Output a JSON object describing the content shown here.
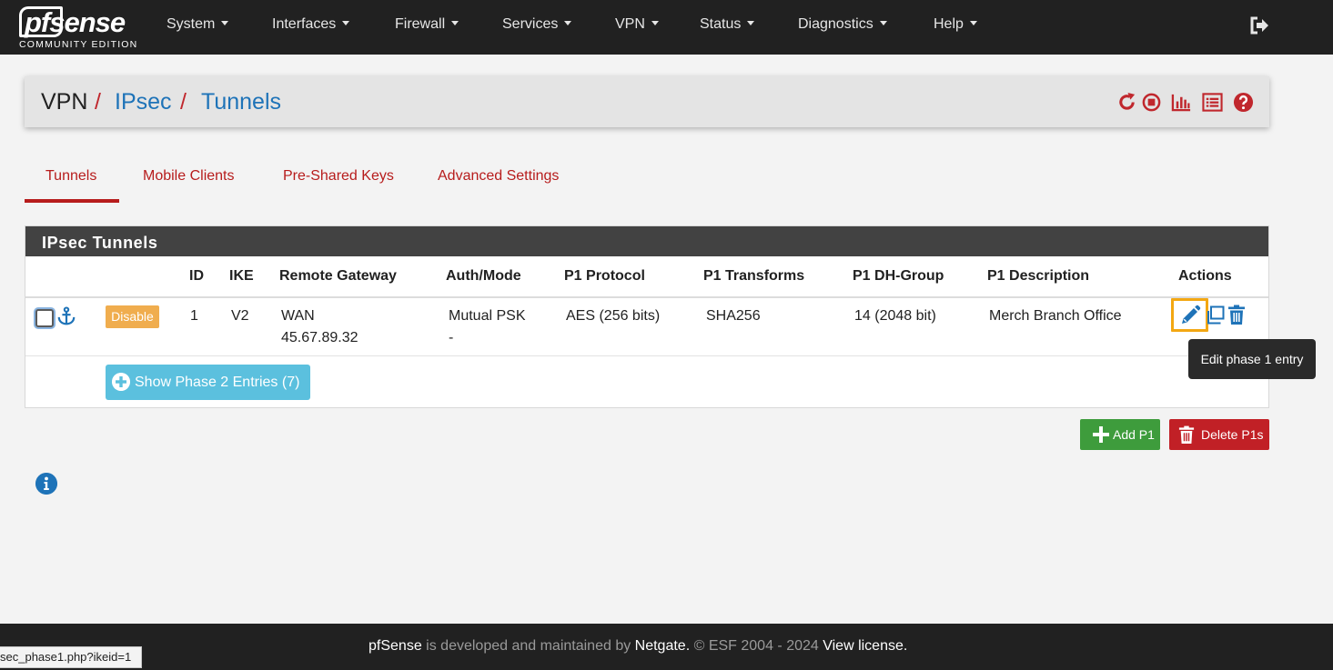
{
  "brand": {
    "name": "pfsense",
    "edition": "COMMUNITY EDITION"
  },
  "nav": {
    "items": [
      "System",
      "Interfaces",
      "Firewall",
      "Services",
      "VPN",
      "Status",
      "Diagnostics",
      "Help"
    ],
    "logout_icon": "sign-out-icon"
  },
  "breadcrumb": {
    "root": "VPN",
    "section": "IPsec",
    "page": "Tunnels",
    "separator": "/"
  },
  "header_icons": [
    "restart-service-icon",
    "stop-service-icon",
    "bar-chart-icon",
    "list-icon",
    "help-icon"
  ],
  "tabs": [
    "Tunnels",
    "Mobile Clients",
    "Pre-Shared Keys",
    "Advanced Settings"
  ],
  "active_tab": "Tunnels",
  "panel": {
    "title": "IPsec Tunnels",
    "columns": [
      "ID",
      "IKE",
      "Remote Gateway",
      "Auth/Mode",
      "P1 Protocol",
      "P1 Transforms",
      "P1 DH-Group",
      "P1 Description",
      "Actions"
    ],
    "rows": [
      {
        "disable_label": "Disable",
        "id": "1",
        "ike": "V2",
        "gateway_iface": "WAN",
        "gateway_ip": "45.67.89.32",
        "auth": "Mutual PSK",
        "mode": "-",
        "protocol": "AES (256 bits)",
        "transforms": "SHA256",
        "dh_group": "14 (2048 bit)",
        "description": "Merch Branch Office"
      }
    ],
    "phase2_button": "Show Phase 2 Entries (7)"
  },
  "tooltip": "Edit phase 1 entry",
  "buttons": {
    "add": "Add P1",
    "delete": "Delete P1s"
  },
  "footer": {
    "brand": "pfSense",
    "developed": " is developed and maintained by ",
    "company": "Netgate.",
    "copyright": " © ESF 2004 - 2024 ",
    "license": "View license."
  },
  "status_bar_url": "sec_phase1.php?ikeid=1",
  "colors": {
    "navbar": "#212121",
    "accent_red": "#b71c1c",
    "link_blue": "#1e73b8",
    "warning": "#f0ad4e",
    "info": "#5bc0de",
    "success": "#3e9c3c",
    "danger": "#c12026"
  }
}
